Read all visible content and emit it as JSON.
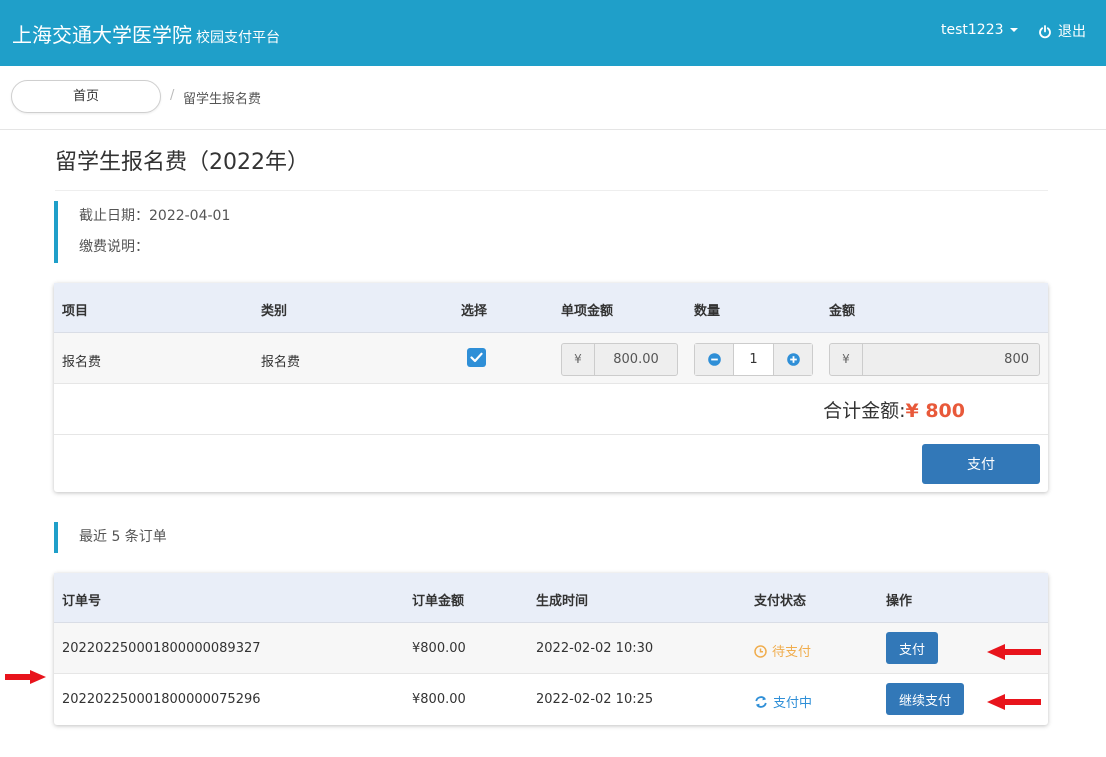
{
  "header": {
    "brand": "上海交通大学医学院",
    "subtitle": "校园支付平台",
    "username": "test1223",
    "logout_label": "退出"
  },
  "breadcrumb": {
    "home": "首页",
    "separator": "/",
    "current": "留学生报名费"
  },
  "page": {
    "title": "留学生报名费（2022年）",
    "deadline": "截止日期：2022-04-01",
    "description": "缴费说明："
  },
  "fee_table": {
    "headers": [
      "项目",
      "类别",
      "选择",
      "单项金额",
      "数量",
      "金额"
    ],
    "row": {
      "item": "报名费",
      "category": "报名费",
      "selected": true,
      "currency": "¥",
      "unit_price": "800.00",
      "quantity": "1",
      "amount": "800"
    },
    "total_label": "合计金额:",
    "total_value": "¥ 800",
    "pay_label": "支付"
  },
  "orders": {
    "section_title": "最近 5 条订单",
    "headers": [
      "订单号",
      "订单金额",
      "生成时间",
      "支付状态",
      "操作"
    ],
    "rows": [
      {
        "id": "20220225000180000008932 7",
        "amount": "¥800.00",
        "time": "2022-02-02 10:30",
        "status": "待支付",
        "action": "支付"
      },
      {
        "id": "202202250001800000075296",
        "amount": "¥800.00",
        "time": "2022-02-02 10:25",
        "status": "支付中",
        "action": "继续支付"
      }
    ]
  },
  "colors": {
    "header_bg": "#1f9fc9",
    "primary_button": "#3278b8",
    "total_accent": "#e8593a",
    "status_wait": "#f0ad4e",
    "status_paying": "#2f8fd7",
    "annotation_arrow": "#e8141c"
  }
}
